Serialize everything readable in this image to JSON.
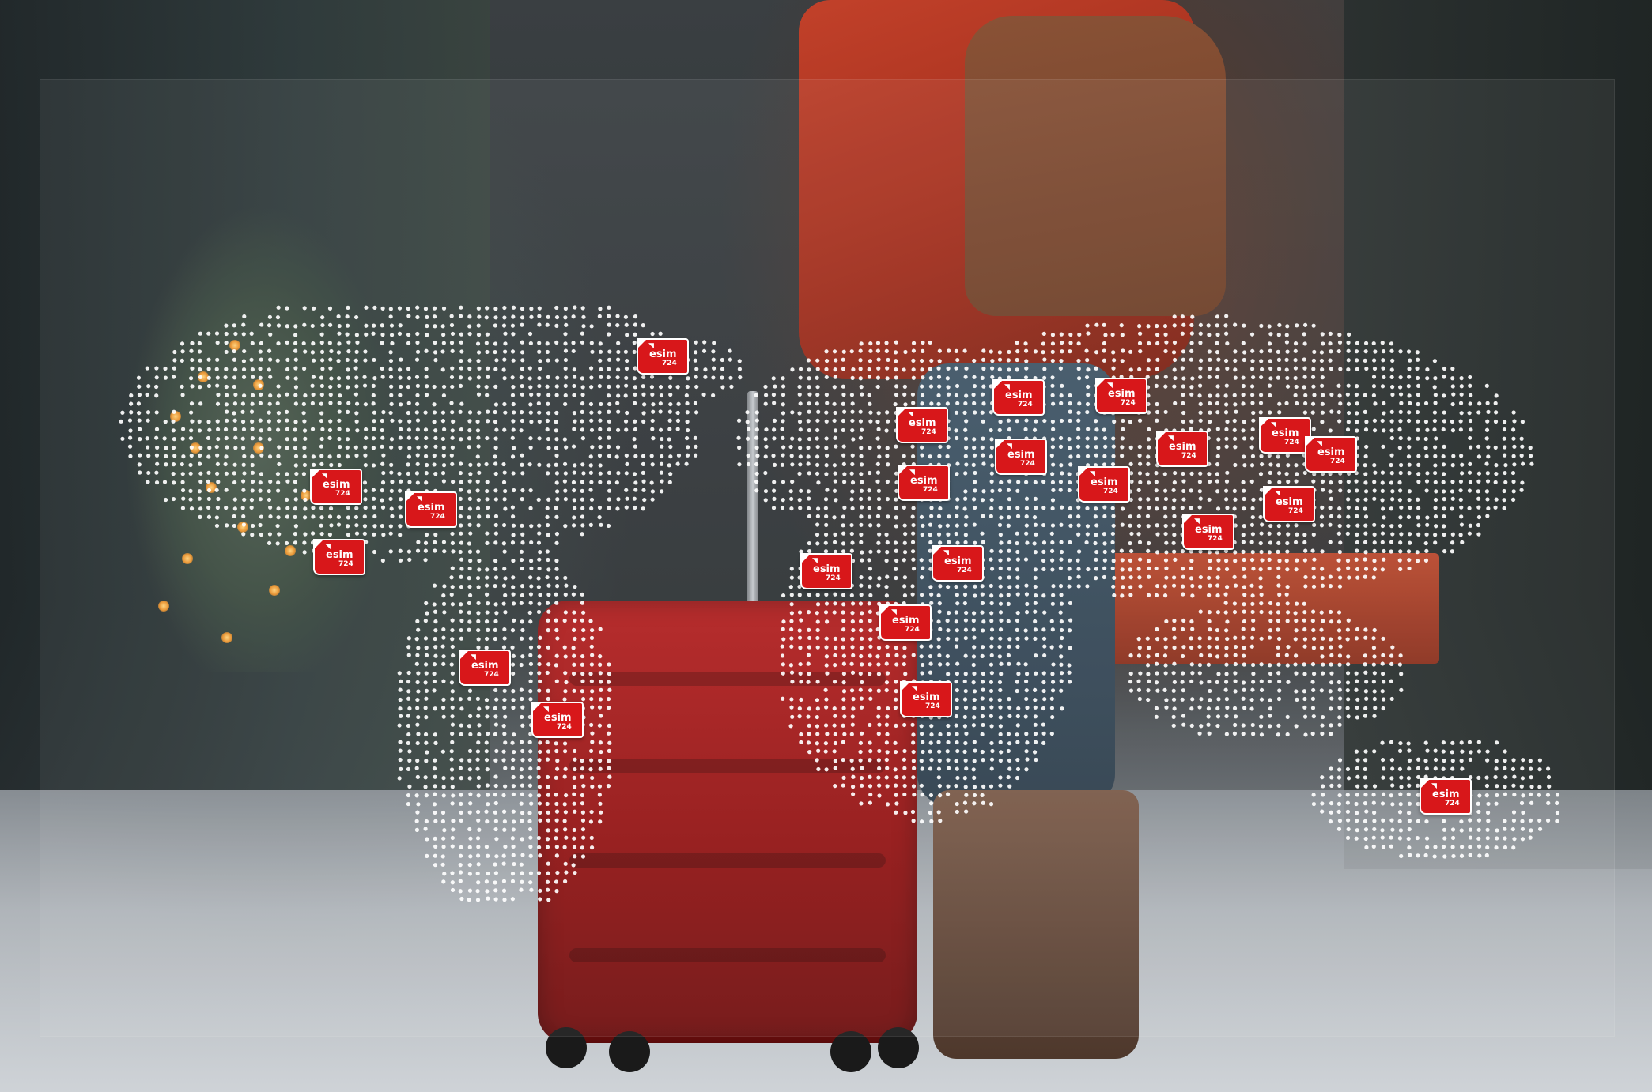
{
  "photo": {
    "subject": "traveler-with-red-suitcase",
    "colors": {
      "coat": "#c2412a",
      "suitcase": "#b32020",
      "tag": "#d8171a",
      "dots": "#ffffff"
    }
  },
  "map": {
    "style": "dot-world-map",
    "dot_color": "#ffffff"
  },
  "tag_brand": {
    "name": "esim",
    "number": "724",
    "icon": "signal-icon"
  },
  "tags": [
    {
      "id": "t01"
    },
    {
      "id": "t02"
    },
    {
      "id": "t03"
    },
    {
      "id": "t04"
    },
    {
      "id": "t05"
    },
    {
      "id": "t06"
    },
    {
      "id": "t07"
    },
    {
      "id": "t08"
    },
    {
      "id": "t09"
    },
    {
      "id": "t10"
    },
    {
      "id": "t11"
    },
    {
      "id": "t12"
    },
    {
      "id": "t13"
    },
    {
      "id": "t14"
    },
    {
      "id": "t15"
    },
    {
      "id": "t16"
    },
    {
      "id": "t17"
    },
    {
      "id": "t18"
    },
    {
      "id": "t19"
    },
    {
      "id": "t20"
    },
    {
      "id": "t21"
    },
    {
      "id": "t22"
    }
  ]
}
